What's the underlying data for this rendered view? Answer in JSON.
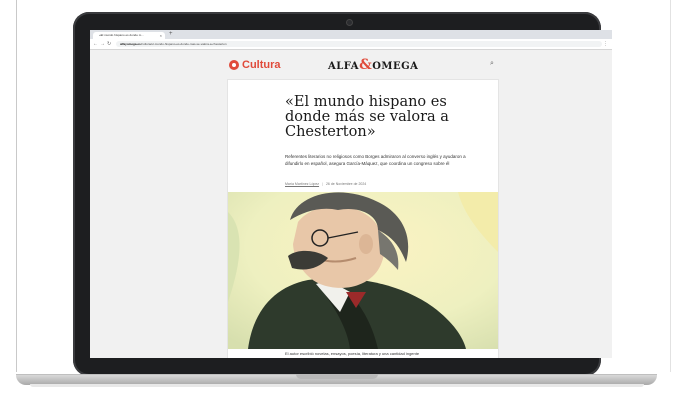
{
  "browser": {
    "tab_title": "«El mundo hispano es donde m...",
    "tab_close": "×",
    "tab_new": "+",
    "url_domain": "alfayomega.es",
    "url_path": "/cultura/el-mundo-hispano-es-donde-mas-se-valora-a-chesterton",
    "back_icon": "←",
    "forward_icon": "→",
    "reload_icon": "↻",
    "menu_icon": "⋮"
  },
  "site": {
    "section": "Cultura",
    "logo_left": "ALFA",
    "logo_amp": "&",
    "logo_right": "OMEGA",
    "search_icon": "⌕"
  },
  "article": {
    "headline": "«El mundo hispano es donde más se valora a Chesterton»",
    "subhead": "Referentes literarios no religiosos como Borges admiraron al converso inglés y ayudaron a difundirlo en español, asegura García-Máquez, que coordina un congreso sobre él",
    "author": "María Martínez López",
    "separator": "|",
    "date": "26 de Noviembre de 2024",
    "caption": "El autor escribió novelas, ensayos, poesía, literatura y una cantidad ingente"
  },
  "colors": {
    "accent": "#e04a3a",
    "lid": "#1d1e20",
    "card_bg": "#ffffff"
  }
}
